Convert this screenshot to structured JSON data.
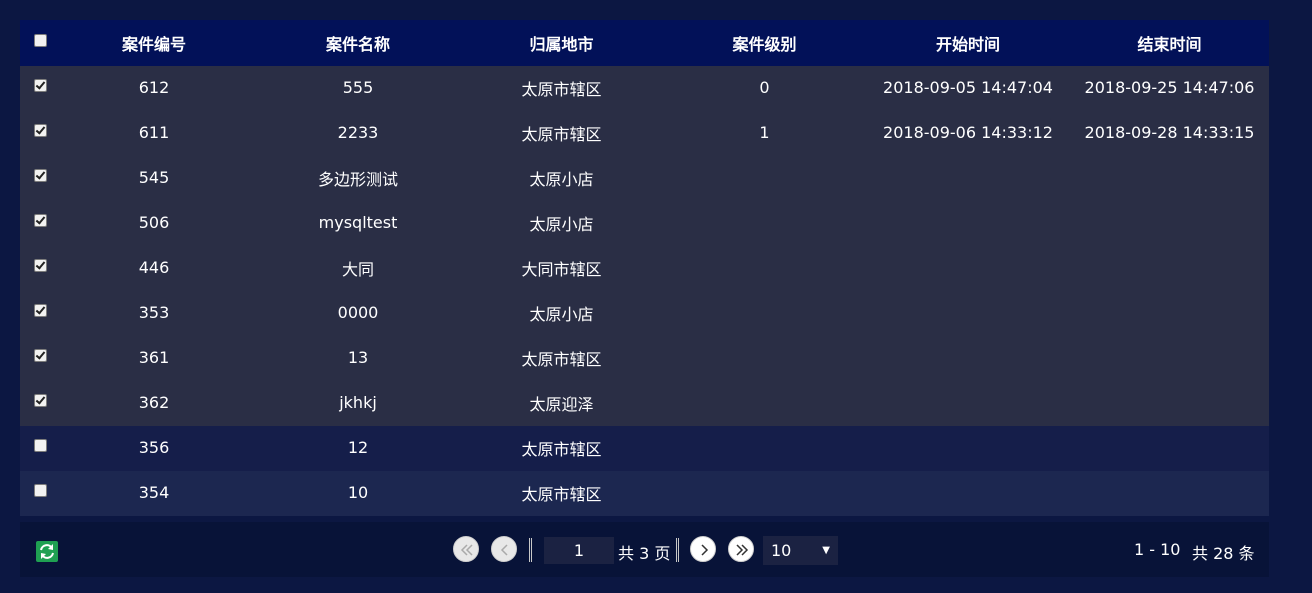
{
  "table": {
    "columns": [
      "案件编号",
      "案件名称",
      "归属地市",
      "案件级别",
      "开始时间",
      "结束时间"
    ],
    "rows": [
      {
        "checked": true,
        "id": "612",
        "name": "555",
        "city": "太原市辖区",
        "level": "0",
        "start": "2018-09-05 14:47:04",
        "end": "2018-09-25 14:47:06"
      },
      {
        "checked": true,
        "id": "611",
        "name": "2233",
        "city": "太原市辖区",
        "level": "1",
        "start": "2018-09-06 14:33:12",
        "end": "2018-09-28 14:33:15"
      },
      {
        "checked": true,
        "id": "545",
        "name": "多边形测试",
        "city": "太原小店",
        "level": "",
        "start": "",
        "end": ""
      },
      {
        "checked": true,
        "id": "506",
        "name": "mysqltest",
        "city": "太原小店",
        "level": "",
        "start": "",
        "end": ""
      },
      {
        "checked": true,
        "id": "446",
        "name": "大同",
        "city": "大同市辖区",
        "level": "",
        "start": "",
        "end": ""
      },
      {
        "checked": true,
        "id": "353",
        "name": "0000",
        "city": "太原小店",
        "level": "",
        "start": "",
        "end": ""
      },
      {
        "checked": true,
        "id": "361",
        "name": "13",
        "city": "太原市辖区",
        "level": "",
        "start": "",
        "end": ""
      },
      {
        "checked": true,
        "id": "362",
        "name": "jkhkj",
        "city": "太原迎泽",
        "level": "",
        "start": "",
        "end": ""
      },
      {
        "checked": false,
        "id": "356",
        "name": "12",
        "city": "太原市辖区",
        "level": "",
        "start": "",
        "end": ""
      },
      {
        "checked": false,
        "id": "354",
        "name": "10",
        "city": "太原市辖区",
        "level": "",
        "start": "",
        "end": ""
      }
    ]
  },
  "pager": {
    "current_page": "1",
    "total_pages_text": "共 3 页",
    "page_size": "10",
    "range_text": "1 - 10",
    "total_text": "共 28 条",
    "icons": {
      "refresh": "refresh-icon",
      "first": "first-page-icon",
      "prev": "prev-page-icon",
      "next": "next-page-icon",
      "last": "last-page-icon",
      "dropdown": "chevron-down-icon"
    }
  },
  "colors": {
    "page_bg": "#0c1742",
    "header_bg": "#021158",
    "checked_row_bg": "#2a2e45",
    "row_bg_a": "#151e4a",
    "row_bg_b": "#1c2750",
    "pager_bg": "#081338",
    "refresh_green": "#1fa052"
  }
}
